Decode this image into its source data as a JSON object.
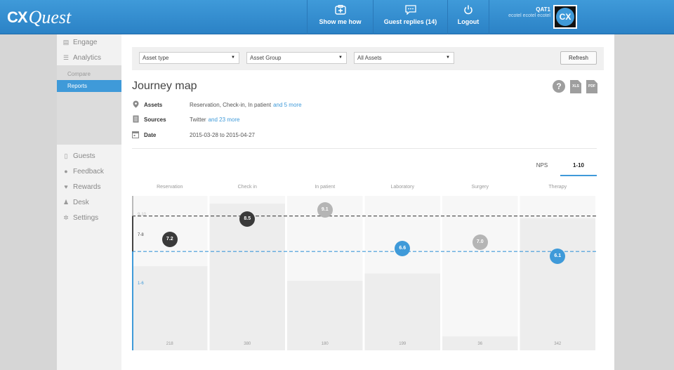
{
  "header": {
    "logo_cx": "CX",
    "logo_quest": "Quest",
    "nav": [
      {
        "label": "Show me how",
        "icon": "medkit-icon"
      },
      {
        "label": "Guest replies (14)",
        "icon": "chat-icon"
      },
      {
        "label": "Logout",
        "icon": "power-icon"
      }
    ],
    "user_name": "QAT1",
    "user_company": "ecotel ecotel ecotel",
    "avatar_text": "CX"
  },
  "sidebar": {
    "top_items": [
      {
        "label": "Engage",
        "icon": "engage-icon"
      },
      {
        "label": "Analytics",
        "icon": "analytics-icon"
      }
    ],
    "sub_items": [
      {
        "label": "Compare",
        "active": false
      },
      {
        "label": "Reports",
        "active": true
      }
    ],
    "bottom_items": [
      {
        "label": "Guests",
        "icon": "guests-icon"
      },
      {
        "label": "Feedback",
        "icon": "feedback-icon"
      },
      {
        "label": "Rewards",
        "icon": "rewards-icon"
      },
      {
        "label": "Desk",
        "icon": "desk-icon"
      },
      {
        "label": "Settings",
        "icon": "settings-icon"
      }
    ]
  },
  "filters": {
    "asset_type": "Asset type",
    "asset_group": "Asset Group",
    "all_assets": "All Assets",
    "refresh": "Refresh"
  },
  "page": {
    "title": "Journey map",
    "tool_help": "?",
    "tool_xls": "XLS",
    "tool_pdf": "PDF"
  },
  "meta": {
    "assets_label": "Assets",
    "assets_value": "Reservation, Check-in, In patient",
    "assets_more": "and 5 more",
    "sources_label": "Sources",
    "sources_value": "Twitter",
    "sources_more": "and 23 more",
    "date_label": "Date",
    "date_value": "2015-03-28 to 2015-04-27"
  },
  "tabs": [
    {
      "label": "NPS",
      "active": false
    },
    {
      "label": "1-10",
      "active": true
    }
  ],
  "colors": {
    "accent": "#3f9ad9",
    "dark_band": "#444444",
    "score_dark": "#3a3a3a",
    "score_light": "#b5b5b5",
    "score_blue": "#3f9ad9"
  },
  "chart_data": {
    "type": "bar",
    "categories": [
      "Reservation",
      "Check in",
      "In patient",
      "Laboratory",
      "Surgery",
      "Therapy"
    ],
    "counts": [
      218,
      380,
      180,
      199,
      36,
      342
    ],
    "scores": [
      7.2,
      8.5,
      9.1,
      6.6,
      7.0,
      6.1
    ],
    "score_tone": [
      "dark",
      "dark",
      "light",
      "blue",
      "light",
      "blue"
    ],
    "bands": [
      "9-10",
      "7-8",
      "1-6"
    ],
    "band_thresholds": [
      8.7,
      6.4
    ],
    "ylim": [
      0,
      10
    ],
    "count_max": 400
  }
}
